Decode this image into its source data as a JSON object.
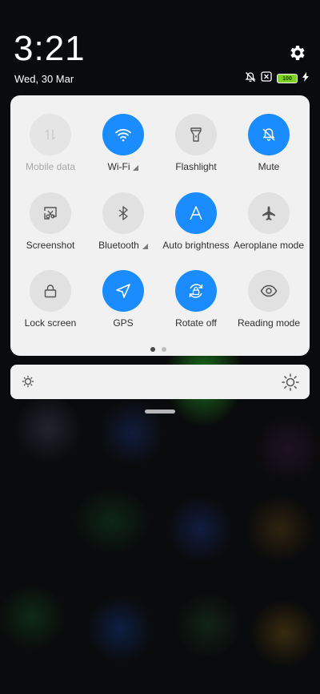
{
  "status": {
    "time": "3:21",
    "date": "Wed, 30 Mar",
    "battery_level": "100",
    "icons": [
      "no-notification-icon",
      "no-sim-icon",
      "battery-icon",
      "charging-icon"
    ]
  },
  "colors": {
    "accent": "#1a8cff",
    "tile_off": "#e1e1e1",
    "panel_bg": "#f1f1f1"
  },
  "tiles": [
    {
      "label": "Mobile data",
      "state": "disabled",
      "icon": "mobile-data-icon"
    },
    {
      "label": "Wi-Fi",
      "state": "on",
      "icon": "wifi-icon",
      "has_detail": true
    },
    {
      "label": "Flashlight",
      "state": "off",
      "icon": "flashlight-icon"
    },
    {
      "label": "Mute",
      "state": "on",
      "icon": "bell-off-icon"
    },
    {
      "label": "Screenshot",
      "state": "off",
      "icon": "screenshot-icon"
    },
    {
      "label": "Bluetooth",
      "state": "off",
      "icon": "bluetooth-icon",
      "has_detail": true
    },
    {
      "label": "Auto brightness",
      "state": "on",
      "icon": "auto-brightness-icon"
    },
    {
      "label": "Aeroplane mode",
      "state": "off",
      "icon": "airplane-icon"
    },
    {
      "label": "Lock screen",
      "state": "off",
      "icon": "lock-icon"
    },
    {
      "label": "GPS",
      "state": "on",
      "icon": "gps-icon"
    },
    {
      "label": "Rotate off",
      "state": "on",
      "icon": "rotation-lock-icon"
    },
    {
      "label": "Reading mode",
      "state": "off",
      "icon": "eye-icon"
    }
  ],
  "pager": {
    "pages": 2,
    "current": 1
  },
  "brightness": {
    "level": 0.0
  }
}
